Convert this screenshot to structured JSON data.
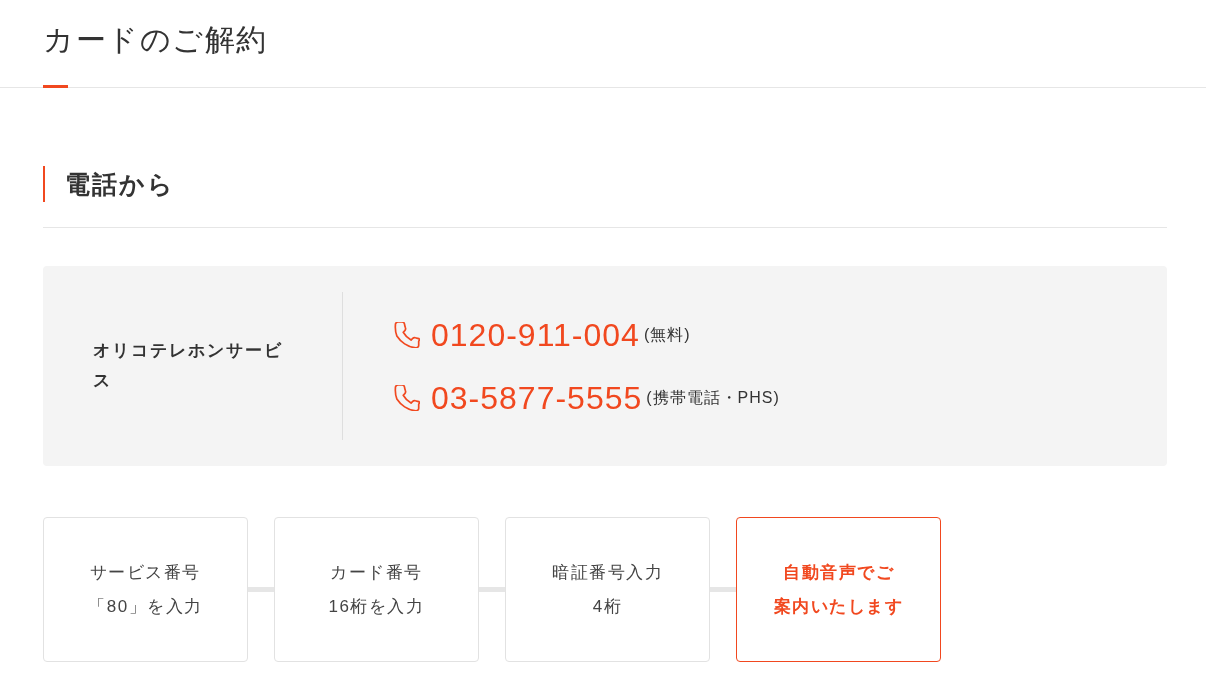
{
  "page_title": "カードのご解約",
  "section": {
    "heading": "電話から",
    "service": {
      "name": "オリコテレホンサービス",
      "phones": [
        {
          "number": "0120-911-004",
          "note": "(無料)"
        },
        {
          "number": "03-5877-5555",
          "note": "(携帯電話・PHS)"
        }
      ]
    }
  },
  "steps": [
    {
      "lines": [
        "サービス番号",
        "「80」を入力"
      ],
      "highlighted": false
    },
    {
      "lines": [
        "カード番号",
        "16桁を入力"
      ],
      "highlighted": false
    },
    {
      "lines": [
        "暗証番号入力",
        "4桁"
      ],
      "highlighted": false
    },
    {
      "lines": [
        "自動音声でご",
        "案内いたします"
      ],
      "highlighted": true
    }
  ]
}
